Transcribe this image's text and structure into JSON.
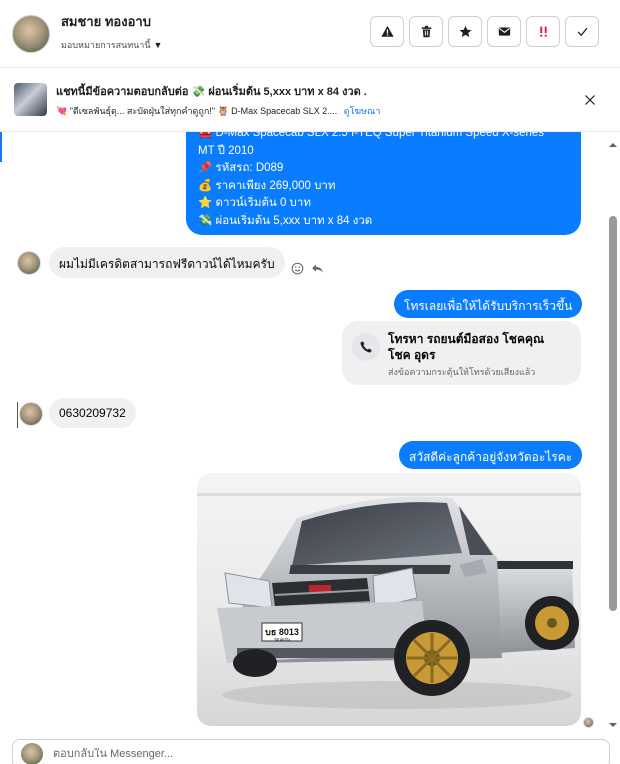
{
  "header": {
    "contact_name": "สมชาย ทองอาบ",
    "assign_label": "มอบหมายการสนทนานี้",
    "actions": [
      {
        "name": "report-button",
        "icon": "warning-icon"
      },
      {
        "name": "delete-button",
        "icon": "trash-icon"
      },
      {
        "name": "star-button",
        "icon": "star-icon"
      },
      {
        "name": "mark-unread-button",
        "icon": "envelope-icon"
      },
      {
        "name": "spam-button",
        "icon": "exclamation-icon"
      },
      {
        "name": "mark-done-button",
        "icon": "check-icon"
      }
    ]
  },
  "ad_banner": {
    "line1": "แชทนี้มีข้อความตอบกลับต่อ 💸 ผ่อนเริ่มต้น 5,xxx บาท x 84 งวด .",
    "line2": "💘 \"ดีเซลพันธุ์ดุ... สะบัดฝุ่นใส่ทุกคำดูถูก!\" 🦉 D-Max Spacecab SLX 2....",
    "link": "ดูโฆษณา"
  },
  "messages": {
    "listing": [
      "🚘 D-Max Spacecab SLX 2.5 I-TEQ Super Titanium Speed X-series",
      "MT ปี 2010",
      "📌 รหัสรถ: D089",
      "💰 ราคาเพียง 269,000 บาท",
      "⭐ ดาวน์เริ่มต้น 0 บาท",
      "💸 ผ่อนเริ่มต้น 5,xxx บาท x 84 งวด"
    ],
    "customer_question": "ผมไม่มีเครดิตสามารถฟรีดาวน์ได้ไหมครับ",
    "page_call_prompt": "โทรเลยเพื่อให้ได้รับบริการเร็วขึ้น",
    "call_card_title": "โทรหา รถยนต์มือสอง โชคคุณ โชค อุดร",
    "call_card_subtitle": "ส่งข้อความกระตุ้นให้โทรด้วยเสียงแล้ว",
    "customer_phone": "0630209732",
    "page_greeting": "สวัสดีค่ะลูกค้าอยู่จังหวัดอะไรคะ",
    "car_plate_text": "บธ 8013",
    "car_plate_province": "ขอนแก่น"
  },
  "composer": {
    "placeholder": "ตอบกลับใน Messenger..."
  },
  "colors": {
    "outgoing_bubble": "#0a7cff",
    "incoming_bubble": "#f0f0f0",
    "accent": "#1877f2"
  }
}
